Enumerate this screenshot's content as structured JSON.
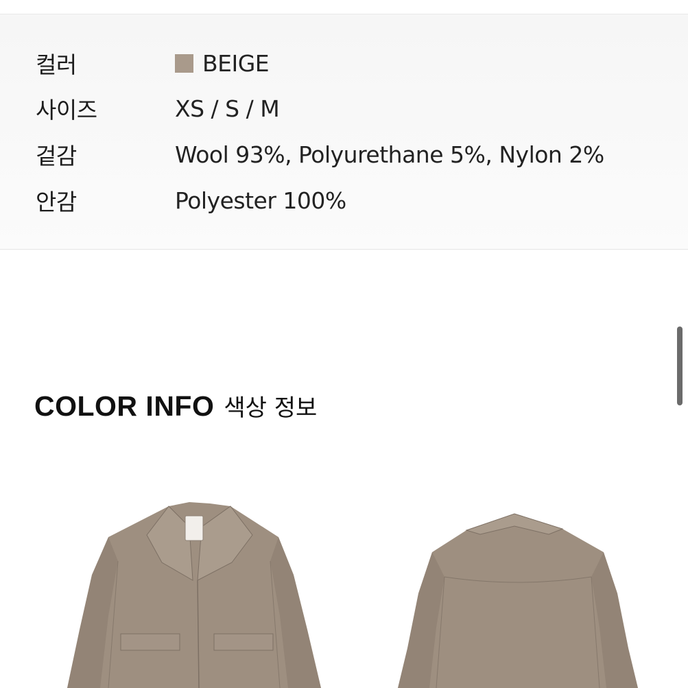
{
  "specs": [
    {
      "label": "컬러",
      "value": "BEIGE",
      "swatch_color": "#a99a8b"
    },
    {
      "label": "사이즈",
      "value": "XS / S / M"
    },
    {
      "label": "겉감",
      "value": "Wool 93%, Polyurethane 5%, Nylon 2%"
    },
    {
      "label": "안감",
      "value": "Polyester 100%"
    }
  ],
  "color_info": {
    "title_en": "COLOR INFO",
    "title_ko": "색상 정보"
  },
  "images": [
    {
      "icon": "jacket-front-image"
    },
    {
      "icon": "jacket-back-image"
    }
  ],
  "colors": {
    "garment": "#9e8f80",
    "garment_shadow": "#8a7c6e",
    "garment_light": "#aa9c8d"
  }
}
